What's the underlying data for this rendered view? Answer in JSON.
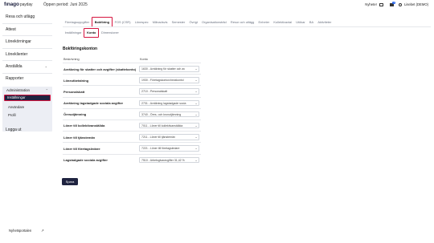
{
  "header": {
    "logo_main": "fınago",
    "logo_sub": "payday",
    "period": "Öppen period: Juni 2025",
    "news_label": "Nyheter",
    "mail_badge": "1",
    "user_label": "Lisebet (DEMO)"
  },
  "sidebar": {
    "items": [
      {
        "label": "Resa och utlägg"
      },
      {
        "label": "Attest"
      },
      {
        "label": "Lönekörningar"
      },
      {
        "label": "Löneklienter"
      },
      {
        "label": "Anställda"
      },
      {
        "label": "Rapporter"
      }
    ],
    "group": {
      "label": "Administration",
      "items": [
        {
          "label": "Inställningar"
        },
        {
          "label": "Användare"
        },
        {
          "label": "Profil"
        }
      ]
    },
    "logout": "Logga ut",
    "footer": "Nyhetsportalen"
  },
  "tabs": [
    "Företagsuppgifter",
    "Bokföring",
    "FOS (CSR)",
    "Lönespec",
    "Månadsvis",
    "Semester",
    "Övrigt",
    "Organisationsträd",
    "Resor och utlägg",
    "Enheter",
    "Kollektivavtal",
    "Utökar",
    "BA",
    "Aktiviteter"
  ],
  "subtabs": [
    "Inställningar",
    "Konto",
    "Dimensioner"
  ],
  "section": {
    "title": "Bokföringskonton",
    "col_name": "Beskrivning",
    "col_account": "Konto",
    "rows": [
      {
        "label": "Avräkning för skatter och avgifter (skattekonto)",
        "value": "1630 - Avräkning för skatter och av"
      },
      {
        "label": "Löneutbetalning",
        "value": "1930 - Företagskonto/checkkonto/"
      },
      {
        "label": "Personalskatt",
        "value": "2710 - Personalskatt"
      },
      {
        "label": "Avräkning lagstadgade sociala avgifter",
        "value": "2731 - Avräkning lagstadgade socia"
      },
      {
        "label": "Öresutjämning",
        "value": "3740 - Öres- och kronutjämning"
      },
      {
        "label": "Löner till kollektivanställda",
        "value": "7011 - Löner till kollektivanställda"
      },
      {
        "label": "Löner till tjänstemän",
        "value": "7211 - Löner till tjänstemän"
      },
      {
        "label": "Löner till företagsledare",
        "value": "7221 - Löner till företagsledare"
      },
      {
        "label": "Lagstadgade sociala avgifter",
        "value": "7510 - Arbetsgivaravgifter 31,42 %"
      }
    ],
    "save_label": "Spara"
  },
  "colors": {
    "navy": "#1f2340",
    "highlight_red": "#d6143f"
  }
}
